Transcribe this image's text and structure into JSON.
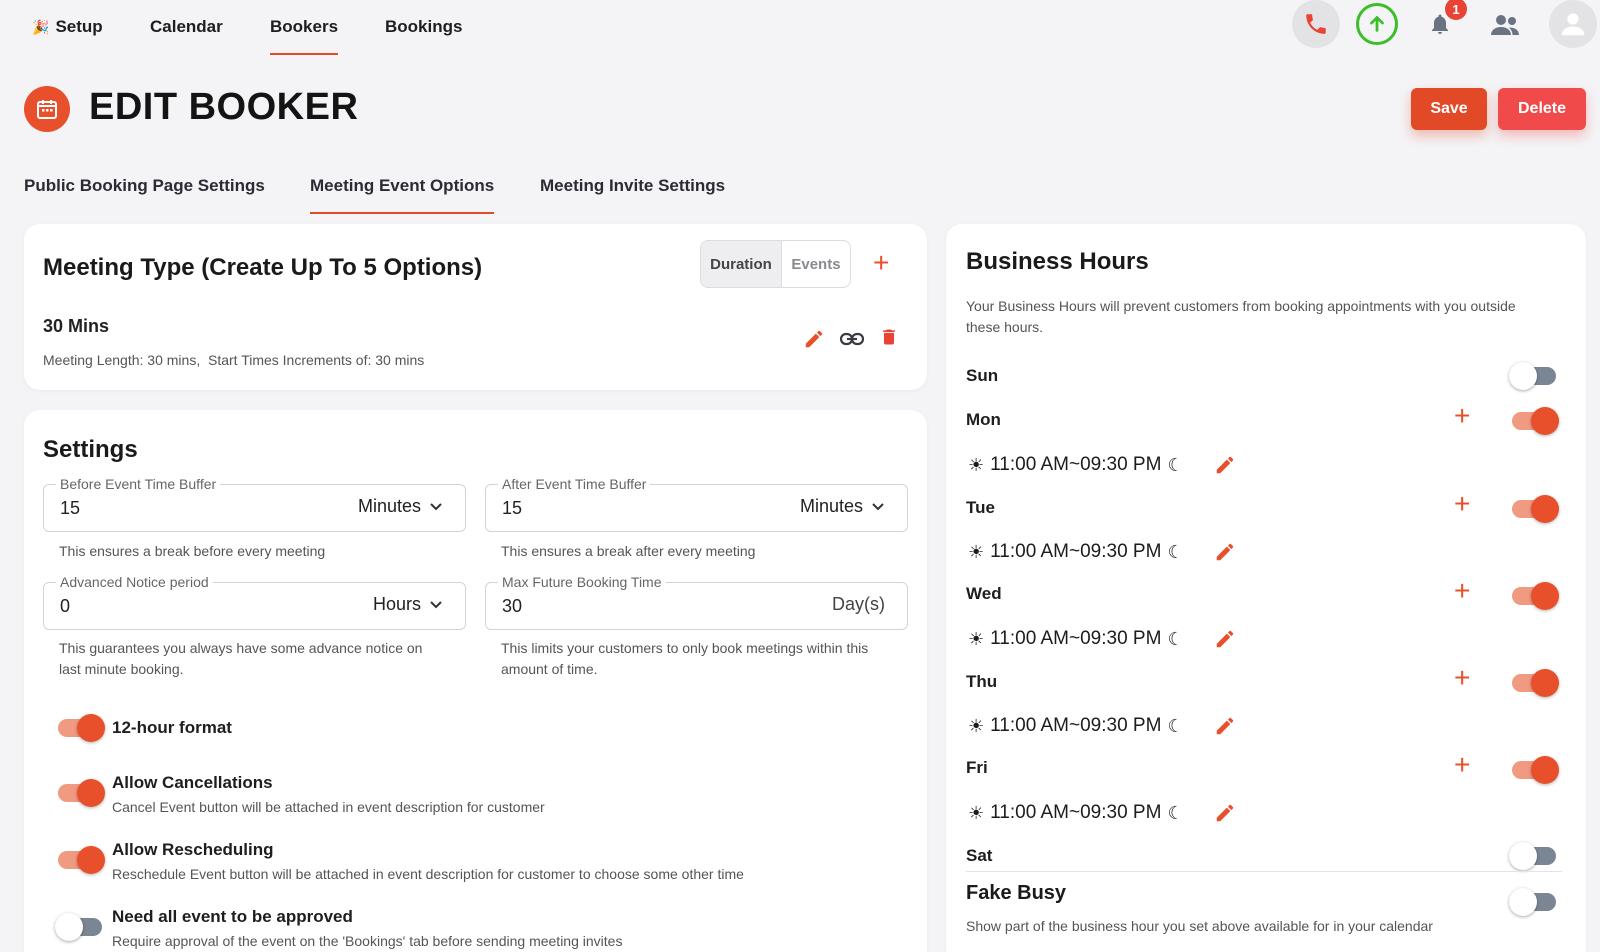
{
  "nav": {
    "setup": "Setup",
    "calendar": "Calendar",
    "bookers": "Bookers",
    "bookings": "Bookings",
    "notification_count": "1"
  },
  "header": {
    "title": "EDIT BOOKER",
    "save_label": "Save",
    "delete_label": "Delete"
  },
  "tabs": [
    {
      "label": "Public Booking Page Settings"
    },
    {
      "label": "Meeting Event Options"
    },
    {
      "label": "Meeting Invite Settings"
    }
  ],
  "meeting_type": {
    "title": "Meeting Type (Create Up To 5 Options)",
    "seg_duration": "Duration",
    "seg_events": "Events",
    "option_name": "30 Mins",
    "option_details": "Meeting Length: 30 mins,  Start Times Increments of: 30 mins"
  },
  "settings": {
    "title": "Settings",
    "before_buffer": {
      "label": "Before Event Time Buffer",
      "value": "15",
      "unit": "Minutes",
      "helper": "This ensures a break before every meeting"
    },
    "after_buffer": {
      "label": "After Event Time Buffer",
      "value": "15",
      "unit": "Minutes",
      "helper": "This ensures a break after every meeting"
    },
    "advance_notice": {
      "label": "Advanced Notice period",
      "value": "0",
      "unit": "Hours",
      "helper_line1": "This guarantees you always have some advance notice on",
      "helper_line2": "last minute booking."
    },
    "max_future": {
      "label": "Max Future Booking Time",
      "value": "30",
      "unit": "Day(s)",
      "helper_line1": "This limits your customers to only book meetings within this",
      "helper_line2": "amount of time."
    },
    "options": [
      {
        "title": "12-hour format",
        "desc": "",
        "enabled": true
      },
      {
        "title": "Allow Cancellations",
        "desc": "Cancel Event button will be attached in event description for customer",
        "enabled": true
      },
      {
        "title": "Allow Rescheduling",
        "desc": "Reschedule Event button will be attached in event description for customer to choose some other time",
        "enabled": true
      },
      {
        "title": "Need all event to be approved",
        "desc": "Require approval of the event on the 'Bookings' tab before sending meeting invites",
        "enabled": false
      }
    ]
  },
  "business_hours": {
    "title": "Business Hours",
    "desc_line1": "Your Business Hours will prevent customers from booking appointments with you outside",
    "desc_line2": "these hours.",
    "days": [
      {
        "name": "Sun",
        "enabled": false
      },
      {
        "name": "Mon",
        "enabled": true,
        "hours": "11:00 AM~09:30 PM"
      },
      {
        "name": "Tue",
        "enabled": true,
        "hours": "11:00 AM~09:30 PM"
      },
      {
        "name": "Wed",
        "enabled": true,
        "hours": "11:00 AM~09:30 PM"
      },
      {
        "name": "Thu",
        "enabled": true,
        "hours": "11:00 AM~09:30 PM"
      },
      {
        "name": "Fri",
        "enabled": true,
        "hours": "11:00 AM~09:30 PM"
      },
      {
        "name": "Sat",
        "enabled": false
      }
    ],
    "fake_busy": {
      "title": "Fake Busy",
      "desc": "Show part of the business hour you set above available for in your calendar",
      "enabled": false
    }
  },
  "colors": {
    "accent": "#e8502c",
    "danger": "#f04a4a",
    "upload_green": "#3dbd2a"
  }
}
